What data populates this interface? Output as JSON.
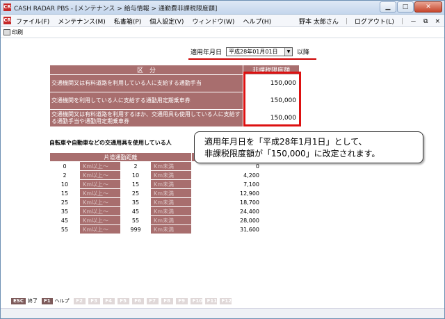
{
  "window": {
    "title": "CASH RADAR PBS - [メンテナンス > 給与情報 > 通勤費非課税限度額]",
    "app_badge": "CR"
  },
  "menu": {
    "items": [
      "ファイル(F)",
      "メンテナンス(M)",
      "私書箱(P)",
      "個人設定(V)",
      "ウィンドウ(W)",
      "ヘルプ(H)"
    ],
    "user": "野本 太郎さん",
    "logout": "ログアウト(L)"
  },
  "toolbar": {
    "print_label": "印刷"
  },
  "date_filter": {
    "label": "適用年月日",
    "value": "平成28年01月01日",
    "suffix": "以降"
  },
  "limits_table": {
    "headers": [
      "区　分",
      "非課税限度額"
    ],
    "rows": [
      {
        "label": "交通機関又は有料道路を利用している人に支給する通勤手当",
        "amount": "150,000"
      },
      {
        "label": "交通機関を利用している人に支給する通勤用定期乗車券",
        "amount": "150,000"
      },
      {
        "label": "交通機関又は有料道路を利用するほか、交通用具も使用している人に支給する通勤手当や通勤用定期乗車券",
        "amount": "150,000"
      }
    ]
  },
  "vehicle_caption": "自転車や自動車などの交通用具を使用している人",
  "distance_table": {
    "header": "片道通勤距離",
    "unit_from": "Km以上～",
    "unit_to": "Km未満",
    "rows": [
      {
        "from": "0",
        "to": "2",
        "amount": "0"
      },
      {
        "from": "2",
        "to": "10",
        "amount": "4,200"
      },
      {
        "from": "10",
        "to": "15",
        "amount": "7,100"
      },
      {
        "from": "15",
        "to": "25",
        "amount": "12,900"
      },
      {
        "from": "25",
        "to": "35",
        "amount": "18,700"
      },
      {
        "from": "35",
        "to": "45",
        "amount": "24,400"
      },
      {
        "from": "45",
        "to": "55",
        "amount": "28,000"
      },
      {
        "from": "55",
        "to": "999",
        "amount": "31,600"
      }
    ]
  },
  "callout": {
    "line1": "適用年月日を「平成28年1月1日」として、",
    "line2": "非課税限度額が「150,000」に改定されます。"
  },
  "fkeys": {
    "esc": "ESC",
    "esc_label": "終了",
    "f1": "F1",
    "f1_label": "ヘルプ",
    "disabled": [
      "F2",
      "F3",
      "F4",
      "F5",
      "F6",
      "F7",
      "F8",
      "F9",
      "F10",
      "F11",
      "F12"
    ]
  },
  "colors": {
    "header_bg": "#a86e6e",
    "highlight": "#dd1111"
  }
}
